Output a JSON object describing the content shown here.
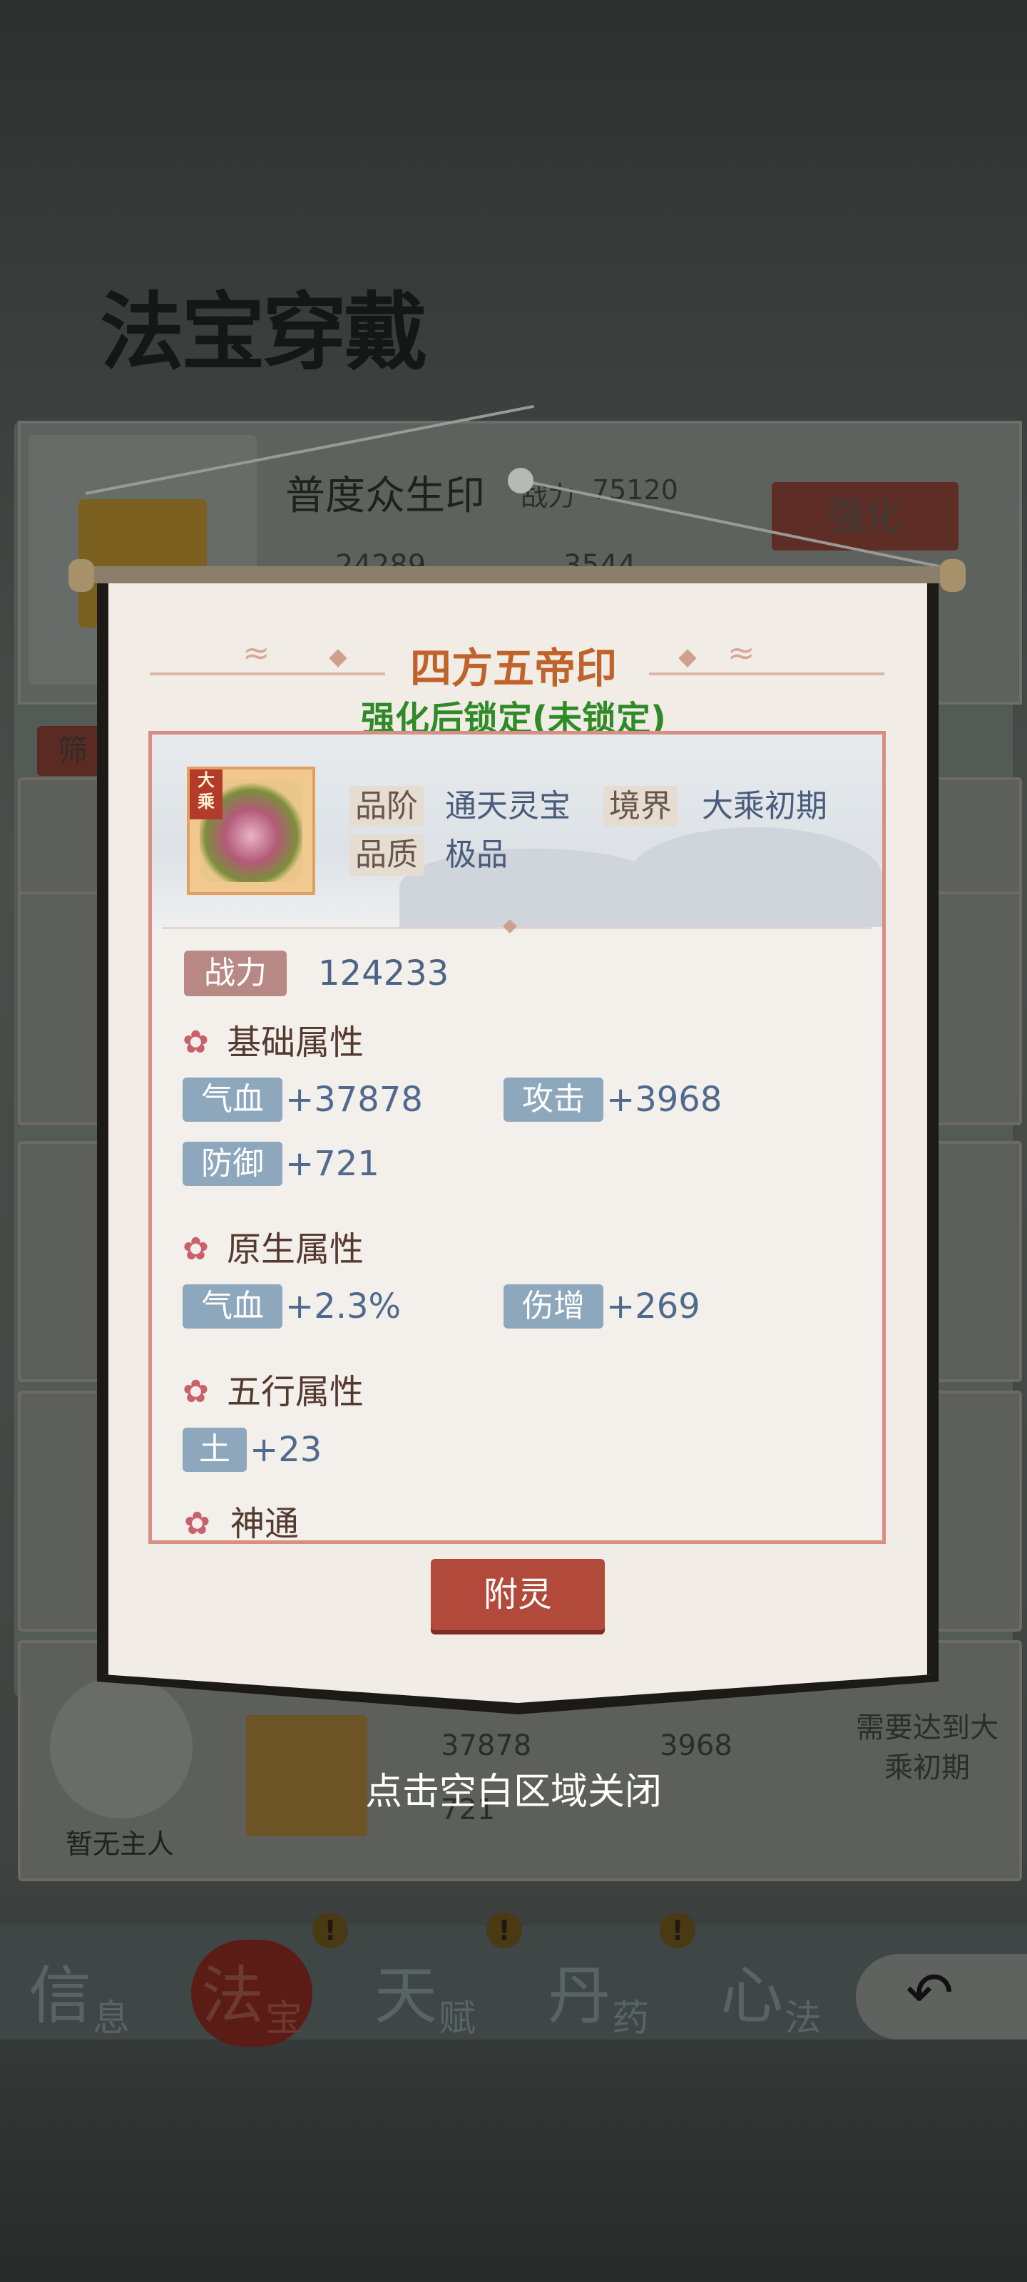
{
  "background": {
    "page_title": "法宝穿戴",
    "equipped": {
      "name": "普度众生印",
      "power_label": "战力",
      "power_value": "75120",
      "stat1": "24289",
      "stat2": "3544",
      "strengthen_label": "强化"
    },
    "filter_label": "筛",
    "rows": [
      {
        "owner": "暂无主人",
        "need": "需要达到大乘初期",
        "stat1": "37878",
        "stat2": "3968",
        "stat3": "721"
      }
    ],
    "tabs": [
      {
        "big": "信",
        "small": "息"
      },
      {
        "big": "法",
        "small": "宝"
      },
      {
        "big": "天",
        "small": "赋"
      },
      {
        "big": "丹",
        "small": "药"
      },
      {
        "big": "心",
        "small": "法"
      }
    ],
    "badge_text": "!"
  },
  "popup": {
    "item_name": "四方五帝印",
    "lock_status": "强化后锁定(未锁定)",
    "icon_tag": "大乘",
    "grade_label": "品阶",
    "grade_value": "通天灵宝",
    "realm_label": "境界",
    "realm_value": "大乘初期",
    "quality_label": "品质",
    "quality_value": "极品",
    "power_label": "战力",
    "power_value": "124233",
    "sections": {
      "basic": {
        "title": "基础属性",
        "stats": [
          {
            "label": "气血",
            "value": "+37878"
          },
          {
            "label": "攻击",
            "value": "+3968"
          },
          {
            "label": "防御",
            "value": "+721"
          }
        ]
      },
      "native": {
        "title": "原生属性",
        "stats": [
          {
            "label": "气血",
            "value": "+2.3%"
          },
          {
            "label": "伤增",
            "value": "+269"
          }
        ]
      },
      "five_elements": {
        "title": "五行属性",
        "stats": [
          {
            "label": "土",
            "value": "+23"
          }
        ]
      },
      "divine": {
        "title": "神通"
      }
    },
    "attach_button": "附灵",
    "close_hint": "点击空白区域关闭"
  },
  "colors": {
    "title_orange": "#c0632a",
    "status_green": "#2f8a28",
    "button_red": "#b24a3c",
    "stat_chip_blue": "#8da7bd"
  }
}
